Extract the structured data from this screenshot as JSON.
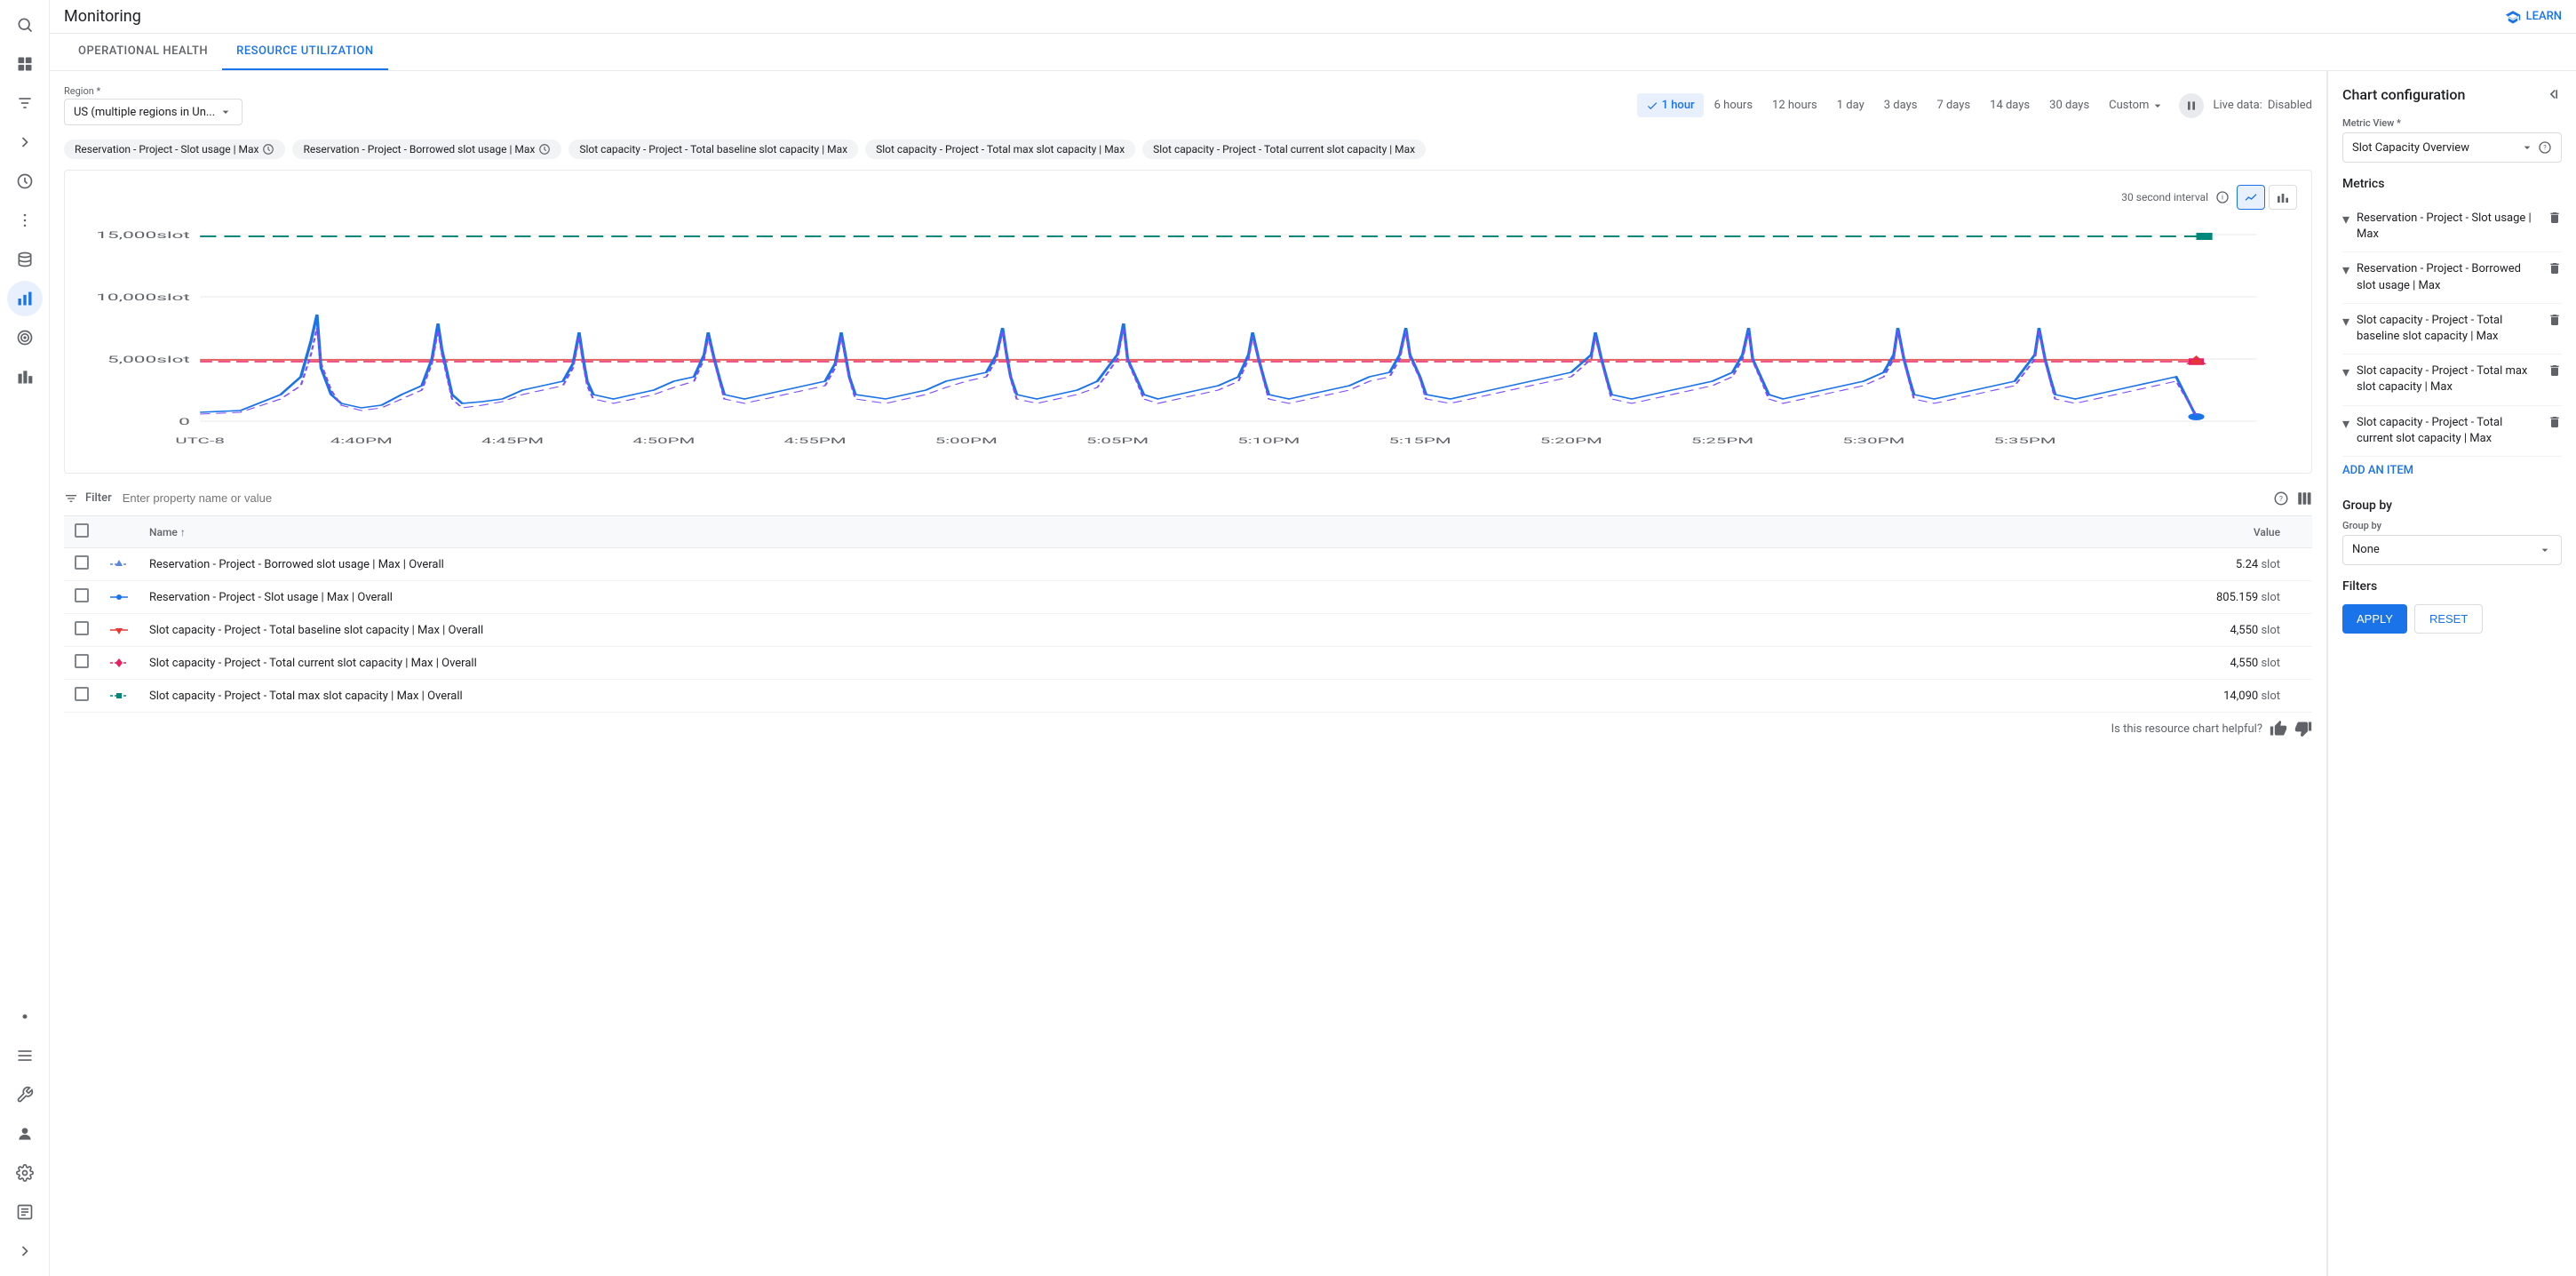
{
  "app": {
    "title": "Monitoring",
    "learn_label": "LEARN"
  },
  "tabs": [
    {
      "id": "operational-health",
      "label": "OPERATIONAL HEALTH",
      "active": false
    },
    {
      "id": "resource-utilization",
      "label": "RESOURCE UTILIZATION",
      "active": true
    }
  ],
  "region": {
    "label": "Region *",
    "value": "US (multiple regions in Un..."
  },
  "time_buttons": [
    {
      "label": "1 hour",
      "active": true
    },
    {
      "label": "6 hours",
      "active": false
    },
    {
      "label": "12 hours",
      "active": false
    },
    {
      "label": "1 day",
      "active": false
    },
    {
      "label": "3 days",
      "active": false
    },
    {
      "label": "7 days",
      "active": false
    },
    {
      "label": "14 days",
      "active": false
    },
    {
      "label": "30 days",
      "active": false
    },
    {
      "label": "Custom",
      "active": false
    }
  ],
  "live_data": {
    "label": "Live data:",
    "status": "Disabled"
  },
  "metric_pills": [
    {
      "label": "Reservation - Project - Slot usage | Max",
      "has_clock": true
    },
    {
      "label": "Reservation - Project - Borrowed slot usage | Max",
      "has_clock": true
    },
    {
      "label": "Slot capacity - Project - Total baseline slot capacity | Max",
      "has_clock": false
    },
    {
      "label": "Slot capacity - Project - Total max slot capacity | Max",
      "has_clock": false
    },
    {
      "label": "Slot capacity - Project - Total current slot capacity | Max",
      "has_clock": false
    }
  ],
  "chart": {
    "interval_label": "30 second interval",
    "y_labels": [
      "15,000slot",
      "10,000slot",
      "5,000slot",
      "0"
    ],
    "x_labels": [
      "UTC-8",
      "4:40PM",
      "4:45PM",
      "4:50PM",
      "4:55PM",
      "5:00PM",
      "5:05PM",
      "5:10PM",
      "5:15PM",
      "5:20PM",
      "5:25PM",
      "5:30PM",
      "5:35PM"
    ]
  },
  "filter": {
    "label": "Filter",
    "placeholder": "Enter property name or value"
  },
  "table": {
    "columns": [
      "Name",
      "Value"
    ],
    "rows": [
      {
        "name": "Reservation - Project - Borrowed slot usage | Max | Overall",
        "value": "5.24",
        "unit": "slot",
        "color": "#5c85de",
        "line_style": "dashed-up"
      },
      {
        "name": "Reservation - Project - Slot usage | Max | Overall",
        "value": "805.159",
        "unit": "slot",
        "color": "#1a73e8",
        "line_style": "solid-circle"
      },
      {
        "name": "Slot capacity - Project - Total baseline slot capacity | Max | Overall",
        "value": "4,550",
        "unit": "slot",
        "color": "#e53935",
        "line_style": "solid-down"
      },
      {
        "name": "Slot capacity - Project - Total current slot capacity | Max | Overall",
        "value": "4,550",
        "unit": "slot",
        "color": "#e91e63",
        "line_style": "dashed-diamond"
      },
      {
        "name": "Slot capacity - Project - Total max slot capacity | Max | Overall",
        "value": "14,090",
        "unit": "slot",
        "color": "#00897b",
        "line_style": "dashed-square"
      }
    ]
  },
  "feedback": {
    "question": "Is this resource chart helpful?"
  },
  "right_panel": {
    "title": "Chart configuration",
    "metric_view": {
      "label": "Metric View *",
      "value": "Slot Capacity Overview"
    },
    "metrics_title": "Metrics",
    "metrics": [
      {
        "label": "Reservation - Project - Slot usage | Max"
      },
      {
        "label": "Reservation - Project - Borrowed slot usage | Max"
      },
      {
        "label": "Slot capacity - Project - Total baseline slot capacity | Max"
      },
      {
        "label": "Slot capacity - Project - Total max slot capacity | Max"
      },
      {
        "label": "Slot capacity - Project - Total current slot capacity | Max"
      }
    ],
    "add_item_label": "ADD AN ITEM",
    "group_by_title": "Group by",
    "group_by_label": "Group by",
    "group_by_value": "None",
    "filters_title": "Filters",
    "apply_label": "APPLY",
    "reset_label": "RESET"
  }
}
